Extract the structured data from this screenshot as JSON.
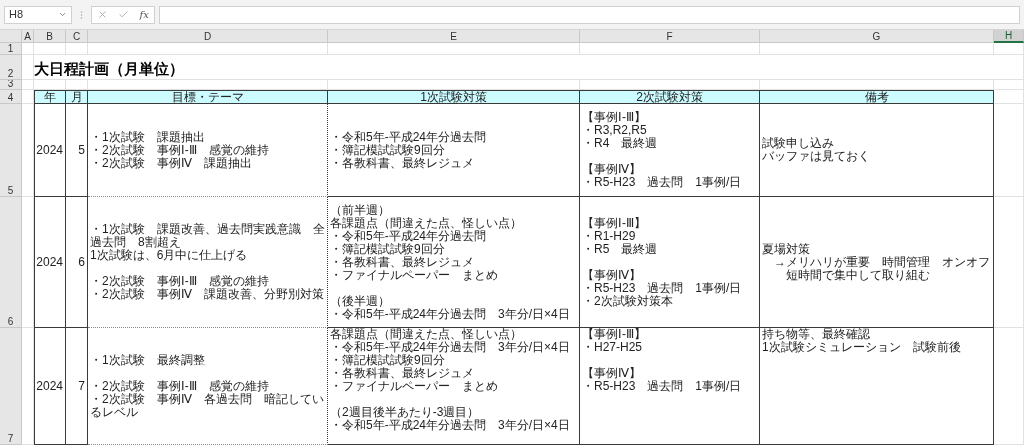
{
  "formula_bar": {
    "name_box": "H8",
    "function_label": "fx"
  },
  "column_headings": [
    {
      "label": "A",
      "selected": false
    },
    {
      "label": "B",
      "selected": false
    },
    {
      "label": "C",
      "selected": false
    },
    {
      "label": "D",
      "selected": false
    },
    {
      "label": "E",
      "selected": false
    },
    {
      "label": "F",
      "selected": false
    },
    {
      "label": "G",
      "selected": false
    },
    {
      "label": "H",
      "selected": true
    }
  ],
  "row_numbers": [
    "1",
    "2",
    "3",
    "4",
    "5",
    "6",
    "7"
  ],
  "title": "大日程計画（月単位）",
  "table": {
    "columns": [
      "年",
      "月",
      "目標・テーマ",
      "1次試験対策",
      "2次試験対策",
      "備考"
    ],
    "rows": [
      {
        "cells": [
          [
            [
              "2024"
            ]
          ],
          [
            [
              "5"
            ]
          ],
          [
            [
              "・1次試験　課題抽出",
              "・2次試験　事例Ⅰ-Ⅲ　感覚の維持",
              "・2次試験　事例Ⅳ　課題抽出"
            ]
          ],
          [
            [
              "・令和5年-平成24年分過去問",
              "・簿記模試試験9回分",
              "・各教科書、最終レジュメ"
            ]
          ],
          [
            [
              "【事例Ⅰ-Ⅲ】",
              "・R3,R2,R5",
              "・R4　最終週"
            ],
            [
              "【事例Ⅳ】",
              "・R5-H23　過去問　1事例/日"
            ]
          ],
          [
            [
              "試験申し込み",
              "バッファは見ておく"
            ]
          ]
        ]
      },
      {
        "cells": [
          [
            [
              "2024"
            ]
          ],
          [
            [
              "6"
            ]
          ],
          [
            [
              "・1次試験　課題改善、過去問実践意識　全過去問　8割超え",
              "1次試験は、6月中に仕上げる"
            ],
            [
              "・2次試験　事例Ⅰ-Ⅲ　感覚の維持",
              "・2次試験　事例Ⅳ　課題改善、分野別対策"
            ]
          ],
          [
            [
              "（前半週）",
              "各課題点（間違えた点、怪しい点）",
              "・令和5年-平成24年分過去問",
              "・簿記模試試験9回分",
              "・各教科書、最終レジュメ",
              "・ファイナルペーパー　まとめ"
            ],
            [
              "（後半週）",
              "・令和5年-平成24年分過去問　3年分/日×4日"
            ]
          ],
          [
            [
              "【事例Ⅰ-Ⅲ】",
              "・R1-H29",
              "・R5　最終週"
            ],
            [
              "【事例Ⅳ】",
              "・R5-H23　過去問　1事例/日",
              "・2次試験対策本"
            ]
          ],
          [
            [
              "夏場対策",
              "　→メリハリが重要　時間管理　オンオフ",
              "　　短時間で集中して取り組む"
            ]
          ]
        ]
      },
      {
        "cells": [
          [
            [
              "2024"
            ]
          ],
          [
            [
              "7"
            ]
          ],
          [
            [
              "・1次試験　最終調整"
            ],
            [
              "・2次試験　事例Ⅰ-Ⅲ　感覚の維持",
              "・2次試験　事例Ⅳ　各過去問　暗記しているレベル"
            ]
          ],
          [
            [
              "各課題点（間違えた点、怪しい点）",
              "・令和5年-平成24年分過去問　3年分/日×4日",
              "・簿記模試試験9回分",
              "・各教科書、最終レジュメ",
              "・ファイナルペーパー　まとめ"
            ],
            [
              "（2週目後半あたり-3週目）",
              "・令和5年-平成24年分過去問　3年分/日×4日"
            ]
          ],
          [
            [
              "【事例Ⅰ-Ⅲ】",
              "・H27-H25"
            ],
            [
              "【事例Ⅳ】",
              "・R5-H23　過去問　1事例/日"
            ]
          ],
          [
            [
              "持ち物等、最終確認",
              "1次試験シミュレーション　試験前後"
            ]
          ]
        ]
      }
    ]
  }
}
